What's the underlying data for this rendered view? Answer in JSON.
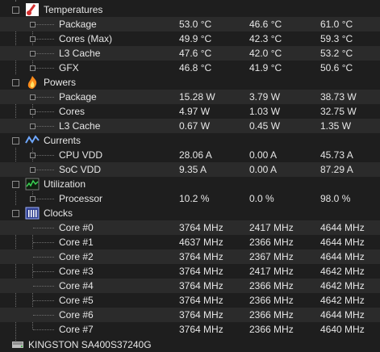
{
  "groups": [
    {
      "name": "Temperatures",
      "icon": "thermometer-icon",
      "rows": [
        {
          "label": "Package",
          "v1": "53.0 °C",
          "v2": "46.6 °C",
          "v3": "61.0 °C"
        },
        {
          "label": "Cores (Max)",
          "v1": "49.9 °C",
          "v2": "42.3 °C",
          "v3": "59.3 °C"
        },
        {
          "label": "L3 Cache",
          "v1": "47.6 °C",
          "v2": "42.0 °C",
          "v3": "53.2 °C"
        },
        {
          "label": "GFX",
          "v1": "46.8 °C",
          "v2": "41.9 °C",
          "v3": "50.6 °C"
        }
      ]
    },
    {
      "name": "Powers",
      "icon": "fire-icon",
      "rows": [
        {
          "label": "Package",
          "v1": "15.28 W",
          "v2": "3.79 W",
          "v3": "38.73 W"
        },
        {
          "label": "Cores",
          "v1": "4.97 W",
          "v2": "1.03 W",
          "v3": "32.75 W"
        },
        {
          "label": "L3 Cache",
          "v1": "0.67 W",
          "v2": "0.45 W",
          "v3": "1.35 W"
        }
      ]
    },
    {
      "name": "Currents",
      "icon": "current-wave-icon",
      "rows": [
        {
          "label": "CPU VDD",
          "v1": "28.06 A",
          "v2": "0.00 A",
          "v3": "45.73 A"
        },
        {
          "label": "SoC VDD",
          "v1": "9.35 A",
          "v2": "0.00 A",
          "v3": "87.29 A"
        }
      ]
    },
    {
      "name": "Utilization",
      "icon": "utilization-graph-icon",
      "rows": [
        {
          "label": "Processor",
          "v1": "10.2 %",
          "v2": "0.0 %",
          "v3": "98.0 %"
        }
      ]
    },
    {
      "name": "Clocks",
      "icon": "clock-bars-icon",
      "rows": [
        {
          "label": "Core #0",
          "v1": "3764 MHz",
          "v2": "2417 MHz",
          "v3": "4644 MHz"
        },
        {
          "label": "Core #1",
          "v1": "4637 MHz",
          "v2": "2366 MHz",
          "v3": "4644 MHz"
        },
        {
          "label": "Core #2",
          "v1": "3764 MHz",
          "v2": "2367 MHz",
          "v3": "4644 MHz"
        },
        {
          "label": "Core #3",
          "v1": "3764 MHz",
          "v2": "2417 MHz",
          "v3": "4642 MHz"
        },
        {
          "label": "Core #4",
          "v1": "3764 MHz",
          "v2": "2366 MHz",
          "v3": "4642 MHz"
        },
        {
          "label": "Core #5",
          "v1": "3764 MHz",
          "v2": "2366 MHz",
          "v3": "4642 MHz"
        },
        {
          "label": "Core #6",
          "v1": "3764 MHz",
          "v2": "2366 MHz",
          "v3": "4644 MHz"
        },
        {
          "label": "Core #7",
          "v1": "3764 MHz",
          "v2": "2366 MHz",
          "v3": "4640 MHz"
        }
      ]
    }
  ],
  "next_device": {
    "name": "KINGSTON SA400S37240G",
    "icon": "disk-drive-icon"
  },
  "colors": {
    "background": "#1e1e1e",
    "row_alt": "#2b2b2b",
    "text": "#e6e6e6"
  }
}
